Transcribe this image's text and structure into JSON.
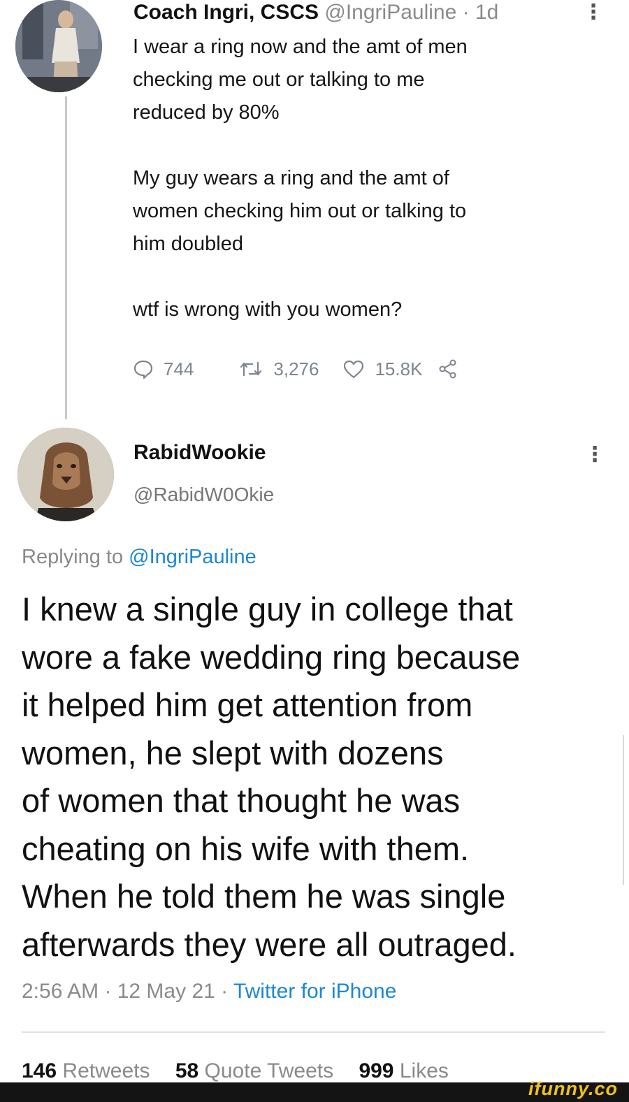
{
  "tweet": {
    "name": "Coach Ingri, CSCS",
    "handle": "@IngriPauline",
    "time": "· 1d",
    "menu": "⋮",
    "lines_p1": [
      "I wear a ring now and the amt of men",
      "checking me out or talking to me",
      "reduced by 80%"
    ],
    "lines_p2": [
      "My guy wears a ring and the amt of",
      "women checking him out or talking to",
      "him doubled"
    ],
    "line_p3": "wtf is wrong with you women?",
    "replies": "744",
    "retweets": "3,276",
    "likes": "15.8K"
  },
  "reply": {
    "name": "RabidWookie",
    "handle": "@RabidW0Okie",
    "menu": "⋮",
    "replying_prefix": "Replying to ",
    "replying_mention": "@IngriPauline",
    "lines": [
      "I knew a single guy in college that",
      "wore a fake wedding ring because",
      "it helped him get attention from",
      "women, he slept with dozens",
      "of women that thought he was",
      "cheating on his wife with them.",
      "When he told them he was single",
      "afterwards they were all outraged."
    ],
    "time": "2:56 AM · 12 May 21 · ",
    "source": "Twitter for iPhone",
    "retweet_count": "146",
    "retweet_label": "Retweets",
    "quote_count": "58",
    "quote_label": "Quote Tweets",
    "like_count": "999",
    "like_label": "Likes"
  },
  "watermark": "ifunny.co",
  "colors": {
    "link": "#1b87d6",
    "muted": "#8a8a8a",
    "watermark": "#f2c40f"
  },
  "icons": [
    "reply-icon",
    "retweet-icon",
    "like-icon",
    "share-icon"
  ]
}
